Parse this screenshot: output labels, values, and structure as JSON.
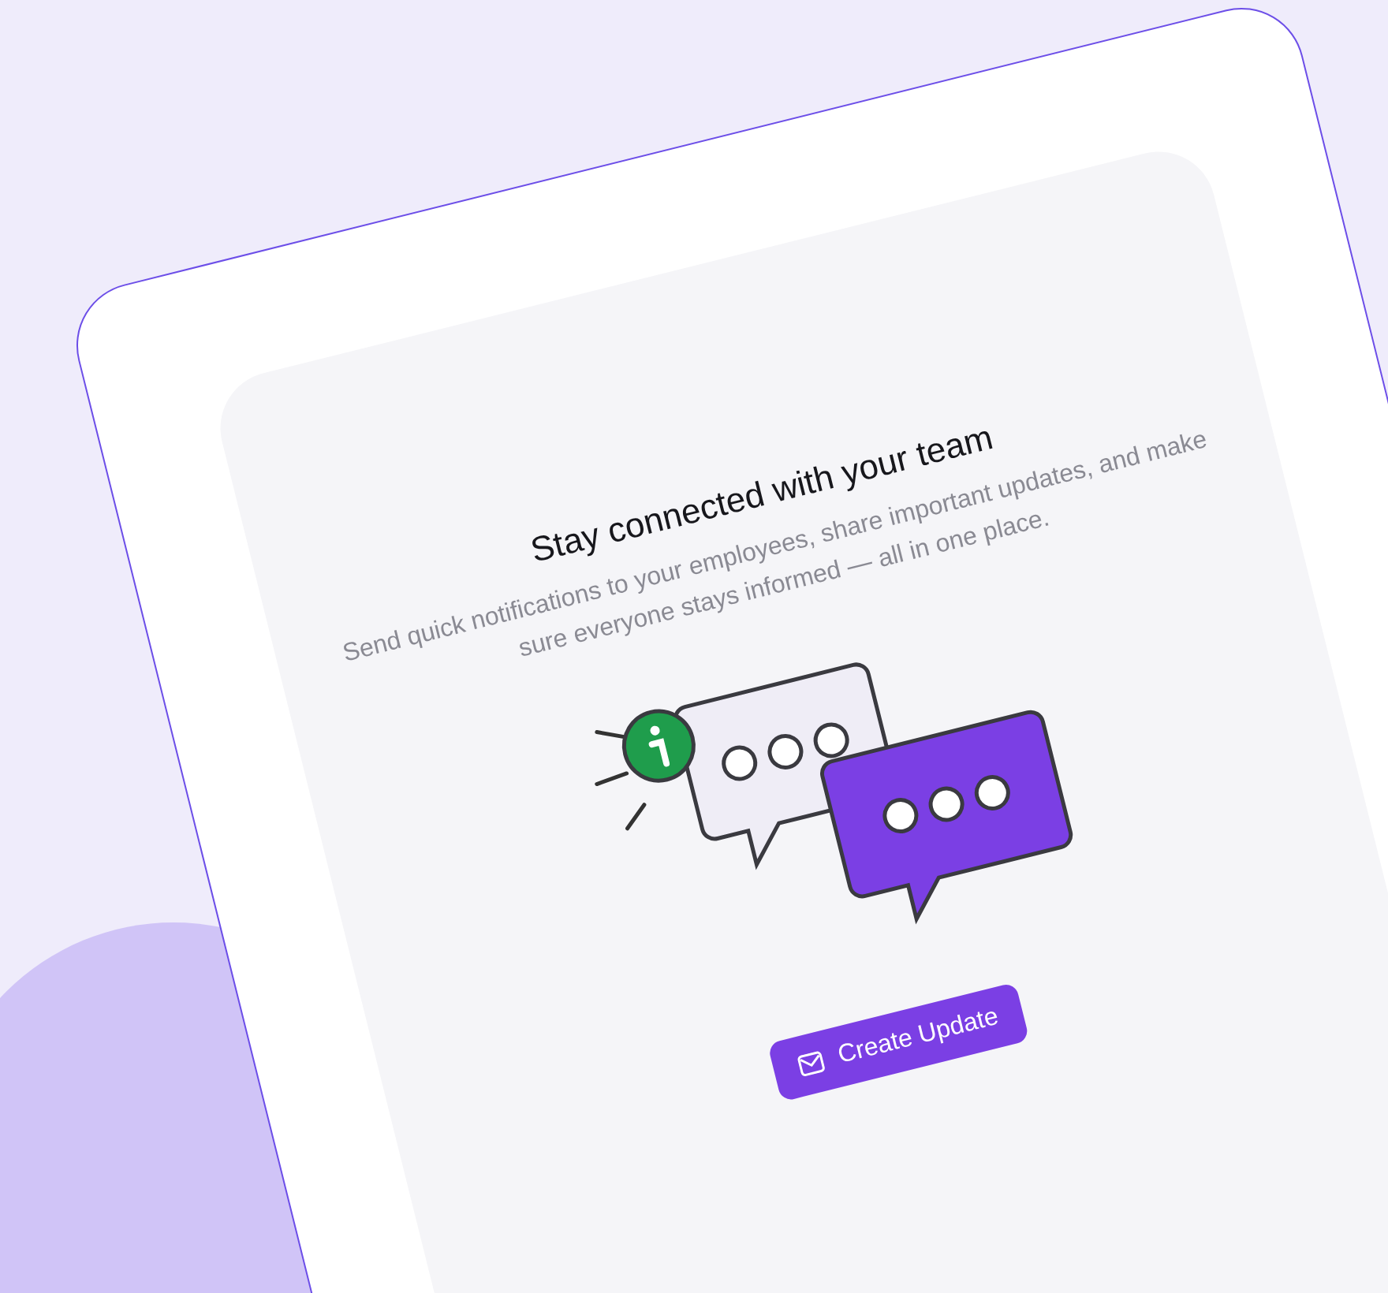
{
  "heading": "Stay connected with your team",
  "description": "Send quick notifications to your employees, share important updates, and make sure everyone stays informed — all in one place.",
  "button": {
    "label": "Create Update"
  }
}
